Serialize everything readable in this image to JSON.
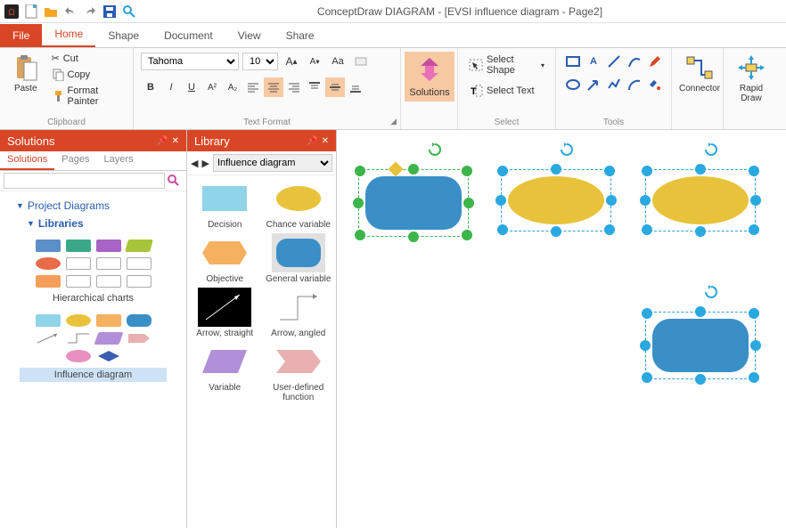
{
  "app": {
    "title": "ConceptDraw DIAGRAM - [EVSI influence diagram - Page2]"
  },
  "tabs": {
    "file": "File",
    "home": "Home",
    "shape": "Shape",
    "document": "Document",
    "view": "View",
    "share": "Share"
  },
  "ribbon": {
    "clipboard": {
      "paste": "Paste",
      "cut": "Cut",
      "copy": "Copy",
      "format_painter": "Format Painter",
      "label": "Clipboard"
    },
    "textformat": {
      "font": "Tahoma",
      "size": "10",
      "label": "Text Format"
    },
    "solutions": {
      "label": "Solutions"
    },
    "select": {
      "select_shape": "Select Shape",
      "select_text": "Select Text",
      "label": "Select"
    },
    "tools": {
      "connector": "Connector",
      "rapid": "Rapid Draw",
      "label": "Tools"
    }
  },
  "solpanel": {
    "title": "Solutions",
    "tabs": {
      "solutions": "Solutions",
      "pages": "Pages",
      "layers": "Layers"
    },
    "tree": {
      "project": "Project Diagrams",
      "libraries": "Libraries",
      "hierarchical": "Hierarchical charts",
      "influence": "Influence diagram"
    }
  },
  "libpanel": {
    "title": "Library",
    "selector": "Influence diagram",
    "items": {
      "decision": "Decision",
      "chance": "Chance variable",
      "objective": "Objective",
      "general": "General variable",
      "arrow_s": "Arrow, straight",
      "arrow_a": "Arrow, angled",
      "variable": "Variable",
      "userfn": "User-defined function"
    }
  }
}
